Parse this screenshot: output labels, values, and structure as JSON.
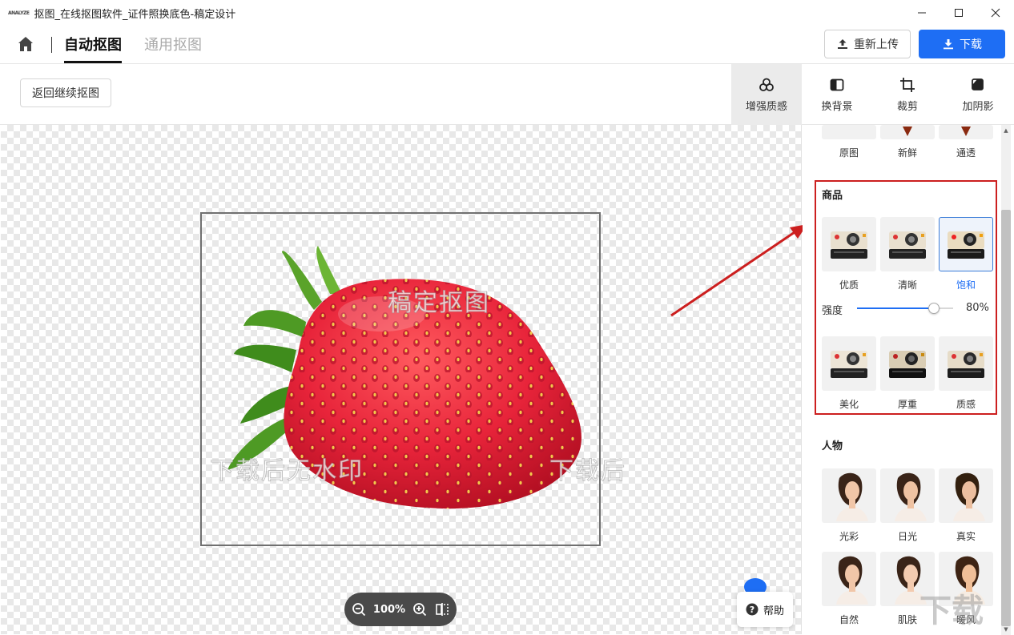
{
  "window": {
    "app_logo": "ANALYZE",
    "title": "抠图_在线抠图软件_证件照换底色-稿定设计",
    "controls": [
      "minimize",
      "maximize",
      "close"
    ]
  },
  "nav": {
    "tabs": [
      {
        "label": "自动抠图",
        "active": true
      },
      {
        "label": "通用抠图",
        "active": false
      }
    ],
    "reupload_label": "重新上传",
    "download_label": "下载"
  },
  "toolbar": {
    "back_label": "返回继续抠图",
    "tools": [
      {
        "label": "增强质感",
        "icon": "enhance-icon",
        "active": true
      },
      {
        "label": "换背景",
        "icon": "background-icon",
        "active": false
      },
      {
        "label": "裁剪",
        "icon": "crop-icon",
        "active": false
      },
      {
        "label": "加阴影",
        "icon": "shadow-icon",
        "active": false
      }
    ]
  },
  "canvas": {
    "watermarks": [
      "稿定抠图",
      "下载后无水印",
      "下载后"
    ],
    "zoom": "100%"
  },
  "help": {
    "label": "帮助"
  },
  "panel": {
    "top_labels": [
      "原图",
      "新鲜",
      "通透"
    ],
    "goods": {
      "title": "商品",
      "row1": [
        "优质",
        "清晰",
        "饱和"
      ],
      "selected": "饱和",
      "intensity_label": "强度",
      "intensity_value": "80%",
      "intensity_fraction": 0.8,
      "row2": [
        "美化",
        "厚重",
        "质感"
      ]
    },
    "people": {
      "title": "人物",
      "row1": [
        "光彩",
        "日光",
        "真实"
      ],
      "row2": [
        "自然",
        "肌肤",
        "暖风"
      ]
    }
  },
  "colors": {
    "accent": "#1e6ef4",
    "highlight": "#cc1f1f"
  },
  "site_watermark": "下载"
}
